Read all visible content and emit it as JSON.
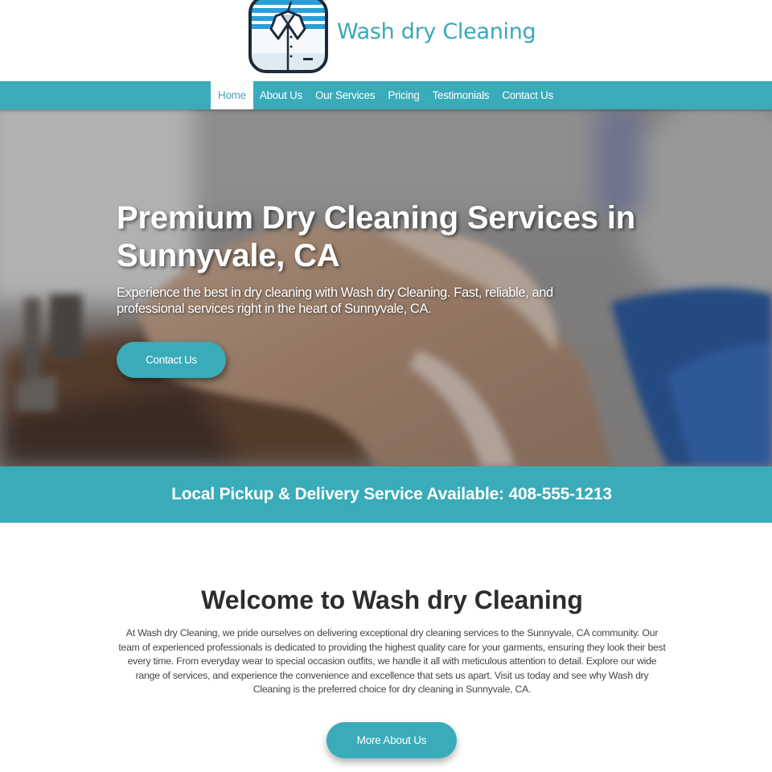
{
  "brand": {
    "name": "Wash dry Cleaning",
    "logo_icon": "shirt-on-hanger-icon",
    "accent_color": "#39abb9"
  },
  "nav": {
    "items": [
      {
        "label": "Home",
        "active": true
      },
      {
        "label": "About Us",
        "active": false
      },
      {
        "label": "Our Services",
        "active": false
      },
      {
        "label": "Pricing",
        "active": false
      },
      {
        "label": "Testimonials",
        "active": false
      },
      {
        "label": "Contact Us",
        "active": false
      }
    ]
  },
  "hero": {
    "title": "Premium Dry Cleaning Services in Sunnyvale, CA",
    "subtitle": "Experience the best in dry cleaning with Wash dry Cleaning. Fast, reliable, and professional services right in the heart of Sunnyvale, CA.",
    "button_label": "Contact Us"
  },
  "banner": {
    "text": "Local Pickup & Delivery Service Available: 408-555-1213"
  },
  "welcome": {
    "title": "Welcome to Wash dry Cleaning",
    "body": "At Wash dry Cleaning, we pride ourselves on delivering exceptional dry cleaning services to the Sunnyvale, CA community. Our team of experienced professionals is dedicated to providing the highest quality care for your garments, ensuring they look their best every time. From everyday wear to special occasion outfits, we handle it all with meticulous attention to detail. Explore our wide range of services, and experience the convenience and excellence that sets us apart. Visit us today and see why Wash dry Cleaning is the preferred choice for dry cleaning in Sunnyvale, CA.",
    "button_label": "More About Us"
  }
}
